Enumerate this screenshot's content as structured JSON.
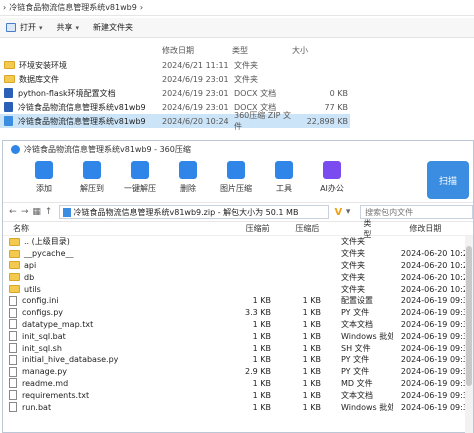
{
  "explorer": {
    "breadcrumb": [
      "冷链食品物流信息管理系统v81wb9"
    ],
    "toolbar": {
      "open": "打开",
      "share": "共享",
      "new_folder": "新建文件夹"
    },
    "columns": {
      "date": "修改日期",
      "type": "类型",
      "size": "大小"
    },
    "rows": [
      {
        "name": "环境安装环境",
        "date": "2024/6/21 11:11",
        "type": "文件夹",
        "size": "",
        "icon": "folder-icon"
      },
      {
        "name": "数据库文件",
        "date": "2024/6/19 23:01",
        "type": "文件夹",
        "size": "",
        "icon": "folder-icon"
      },
      {
        "name": "python-flask环境配置文档",
        "date": "2024/6/19 23:01",
        "type": "DOCX 文档",
        "size": "0 KB",
        "icon": "docx-icon"
      },
      {
        "name": "冷链食品物流信息管理系统v81wb9",
        "date": "2024/6/19 23:01",
        "type": "DOCX 文档",
        "size": "77 KB",
        "icon": "docx-icon"
      },
      {
        "name": "冷链食品物流信息管理系统v81wb9",
        "date": "2024/6/20 10:24",
        "type": "360压缩 ZIP 文件",
        "size": "22,898 KB",
        "icon": "zip-icon",
        "selected": true
      }
    ]
  },
  "zip": {
    "title": "冷链食品物流信息管理系统v81wb9 - 360压缩",
    "tools": [
      {
        "label": "添加",
        "icon": "add-icon",
        "color": "#2f86e8"
      },
      {
        "label": "解压到",
        "icon": "extract-icon",
        "color": "#2f86e8"
      },
      {
        "label": "一键解压",
        "icon": "one-click-extract-icon",
        "color": "#2f86e8"
      },
      {
        "label": "删除",
        "icon": "delete-icon",
        "color": "#2f86e8"
      },
      {
        "label": "图片压缩",
        "icon": "image-compress-icon",
        "color": "#2f86e8"
      },
      {
        "label": "工具",
        "icon": "tools-icon",
        "color": "#2f86e8"
      },
      {
        "label": "AI办公",
        "icon": "ai-icon",
        "color": "#7a4cf0"
      }
    ],
    "scan_label": "扫描",
    "address": "冷链食品物流信息管理系统v81wb9.zip - 解包大小为 50.1 MB",
    "search_placeholder": "搜索包内文件",
    "columns": {
      "name": "名称",
      "compressed": "压缩前",
      "after": "压缩后",
      "type": "类型",
      "date": "修改日期"
    },
    "rows": [
      {
        "name": ".. (上级目录)",
        "before": "",
        "after": "",
        "type": "文件夹",
        "date": "",
        "icon": "folder-icon"
      },
      {
        "name": "__pycache__",
        "before": "",
        "after": "",
        "type": "文件夹",
        "date": "2024-06-20 10:23",
        "icon": "folder-icon"
      },
      {
        "name": "api",
        "before": "",
        "after": "",
        "type": "文件夹",
        "date": "2024-06-20 10:23",
        "icon": "folder-icon"
      },
      {
        "name": "db",
        "before": "",
        "after": "",
        "type": "文件夹",
        "date": "2024-06-20 10:23",
        "icon": "folder-icon"
      },
      {
        "name": "utils",
        "before": "",
        "after": "",
        "type": "文件夹",
        "date": "2024-06-20 10:23",
        "icon": "folder-icon"
      },
      {
        "name": "config.ini",
        "before": "1 KB",
        "after": "1 KB",
        "type": "配置设置",
        "date": "2024-06-19 09:35",
        "icon": "file-icon"
      },
      {
        "name": "configs.py",
        "before": "3.3 KB",
        "after": "1 KB",
        "type": "PY 文件",
        "date": "2024-06-19 09:35",
        "icon": "file-icon"
      },
      {
        "name": "datatype_map.txt",
        "before": "1 KB",
        "after": "1 KB",
        "type": "文本文档",
        "date": "2024-06-19 09:35",
        "icon": "file-icon"
      },
      {
        "name": "init_sql.bat",
        "before": "1 KB",
        "after": "1 KB",
        "type": "Windows 批处理...",
        "date": "2024-06-19 09:35",
        "icon": "file-icon"
      },
      {
        "name": "init_sql.sh",
        "before": "1 KB",
        "after": "1 KB",
        "type": "SH 文件",
        "date": "2024-06-19 09:35",
        "icon": "file-icon"
      },
      {
        "name": "initial_hive_database.py",
        "before": "1 KB",
        "after": "1 KB",
        "type": "PY 文件",
        "date": "2024-06-19 09:35",
        "icon": "file-icon"
      },
      {
        "name": "manage.py",
        "before": "2.9 KB",
        "after": "1 KB",
        "type": "PY 文件",
        "date": "2024-06-19 09:35",
        "icon": "file-icon"
      },
      {
        "name": "readme.md",
        "before": "1 KB",
        "after": "1 KB",
        "type": "MD 文件",
        "date": "2024-06-19 09:35",
        "icon": "file-icon"
      },
      {
        "name": "requirements.txt",
        "before": "1 KB",
        "after": "1 KB",
        "type": "文本文档",
        "date": "2024-06-19 09:35",
        "icon": "file-icon"
      },
      {
        "name": "run.bat",
        "before": "1 KB",
        "after": "1 KB",
        "type": "Windows 批处理...",
        "date": "2024-06-19 09:35",
        "icon": "file-icon"
      }
    ]
  }
}
